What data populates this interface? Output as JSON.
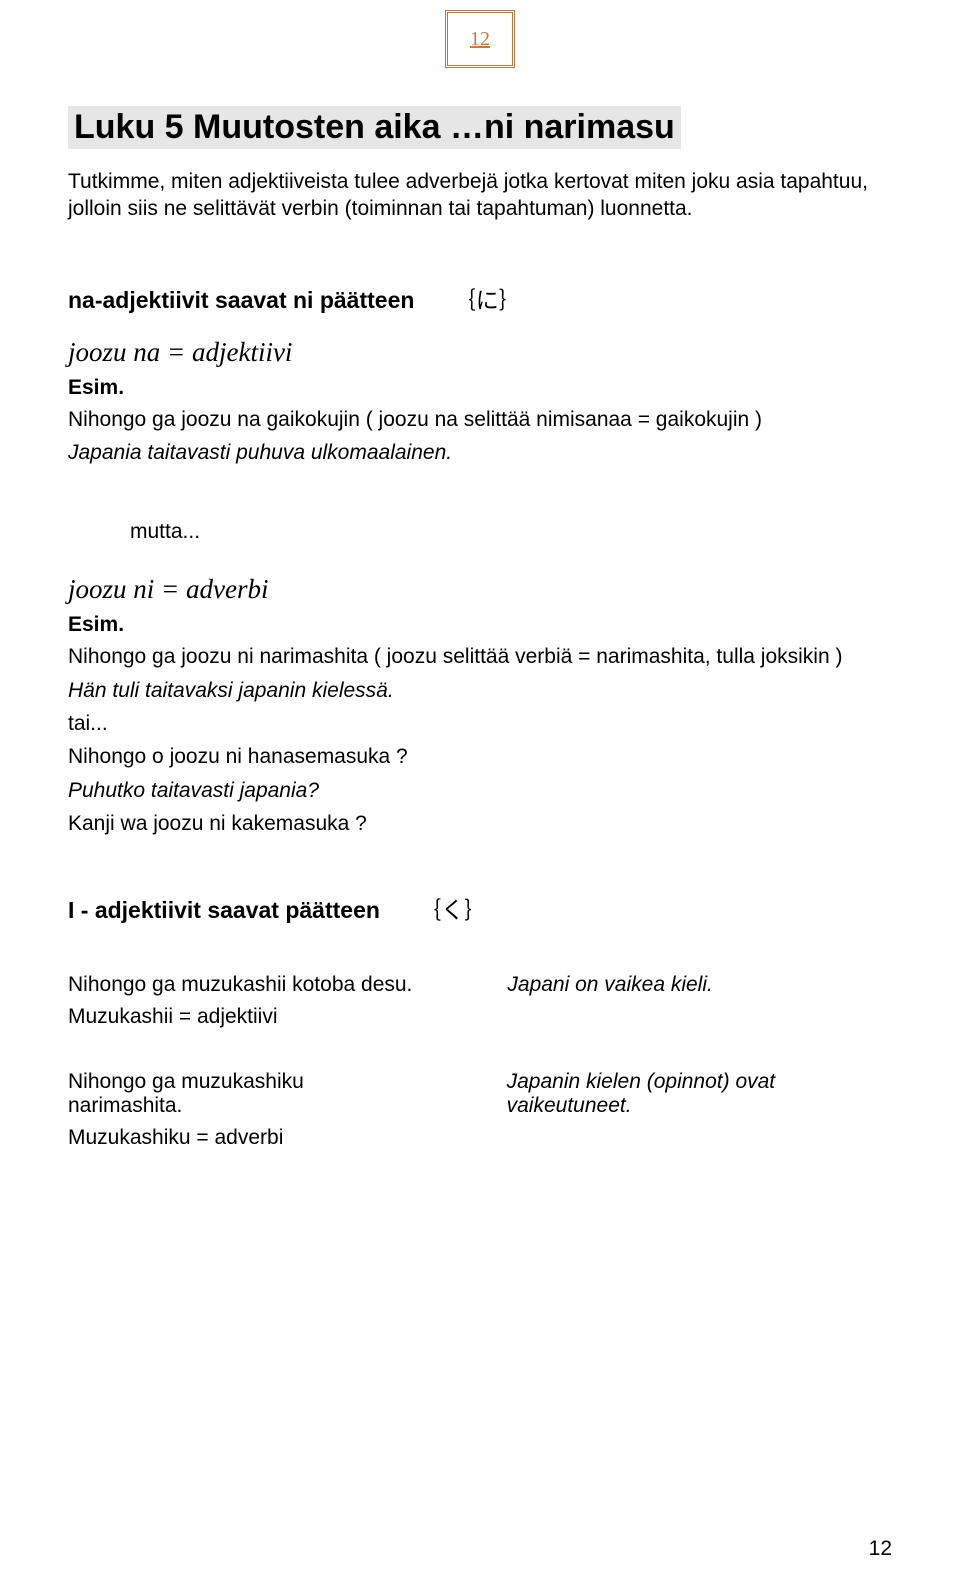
{
  "page_number_top": "12",
  "title": "Luku 5 Muutosten aika …ni   narimasu",
  "intro": "Tutkimme, miten adjektiiveista tulee adverbejä jotka kertovat miten joku asia tapahtuu, jolloin siis ne selittävät verbin (toiminnan tai tapahtuman) luonnetta.",
  "section1": {
    "heading_text": "na-adjektiivit saavat ni päätteen",
    "heading_jp": "｛に｝",
    "def": "joozu na = adjektiivi",
    "esim": "Esim.",
    "ex1": "Nihongo ga joozu na gaikokujin    ( joozu na  selittää nimisanaa = gaikokujin )",
    "ex1_trans": "Japania taitavasti puhuva ulkomaalainen."
  },
  "mutta": "mutta...",
  "section2": {
    "def": "joozu ni  = adverbi",
    "esim": "Esim.",
    "ex1": "Nihongo ga joozu ni narimashita   ( joozu selittää verbiä = narimashita, tulla joksikin )",
    "ex1_trans": "Hän tuli taitavaksi japanin kielessä.",
    "tai": "tai...",
    "ex2": "Nihongo o joozu ni hanasemasuka ?",
    "ex2_trans": "Puhutko taitavasti japania?",
    "ex3": "Kanji wa joozu ni  kakemasuka ?"
  },
  "section3": {
    "heading_text": "I - adjektiivit saavat päätteen",
    "heading_jp": "｛く｝",
    "row1_left": "Nihongo ga muzukashii  kotoba desu.",
    "row1_right": "Japani on vaikea kieli.",
    "row1_sub": "Muzukashii = adjektiivi",
    "row2_left": "Nihongo ga muzukashiku narimashita.",
    "row2_right": "Japanin kielen (opinnot) ovat vaikeutuneet.",
    "row2_sub": "Muzukashiku = adverbi"
  },
  "page_number_bottom": "12"
}
